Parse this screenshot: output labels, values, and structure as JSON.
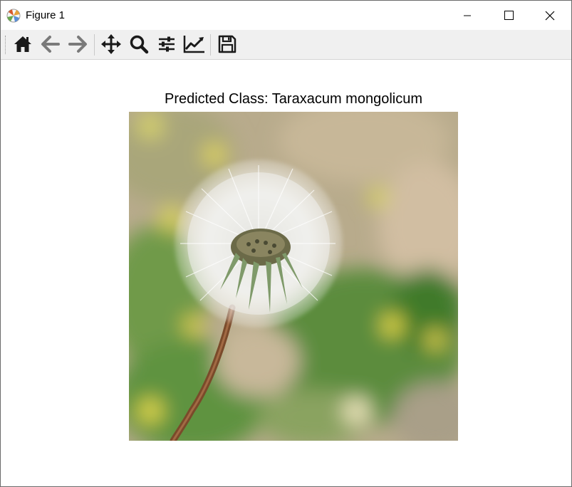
{
  "window": {
    "title": "Figure 1",
    "controls": [
      "minimize",
      "maximize",
      "close"
    ]
  },
  "toolbar": {
    "buttons": [
      {
        "name": "home",
        "icon": "home-icon"
      },
      {
        "name": "back",
        "icon": "arrow-left-icon"
      },
      {
        "name": "forward",
        "icon": "arrow-right-icon"
      },
      {
        "name": "pan",
        "icon": "move-icon"
      },
      {
        "name": "zoom",
        "icon": "magnifier-icon"
      },
      {
        "name": "configure-subplots",
        "icon": "sliders-icon"
      },
      {
        "name": "edit-axis",
        "icon": "line-chart-icon"
      },
      {
        "name": "save",
        "icon": "floppy-disk-icon"
      }
    ]
  },
  "figure": {
    "title": "Predicted Class: Taraxacum mongolicum",
    "image_subject": "dandelion seed head on blurred green and yellow background"
  },
  "colors": {
    "toolbar_bg": "#f0f0f0",
    "icon": "#1a1a1a",
    "window_border": "#6b6b6b"
  }
}
